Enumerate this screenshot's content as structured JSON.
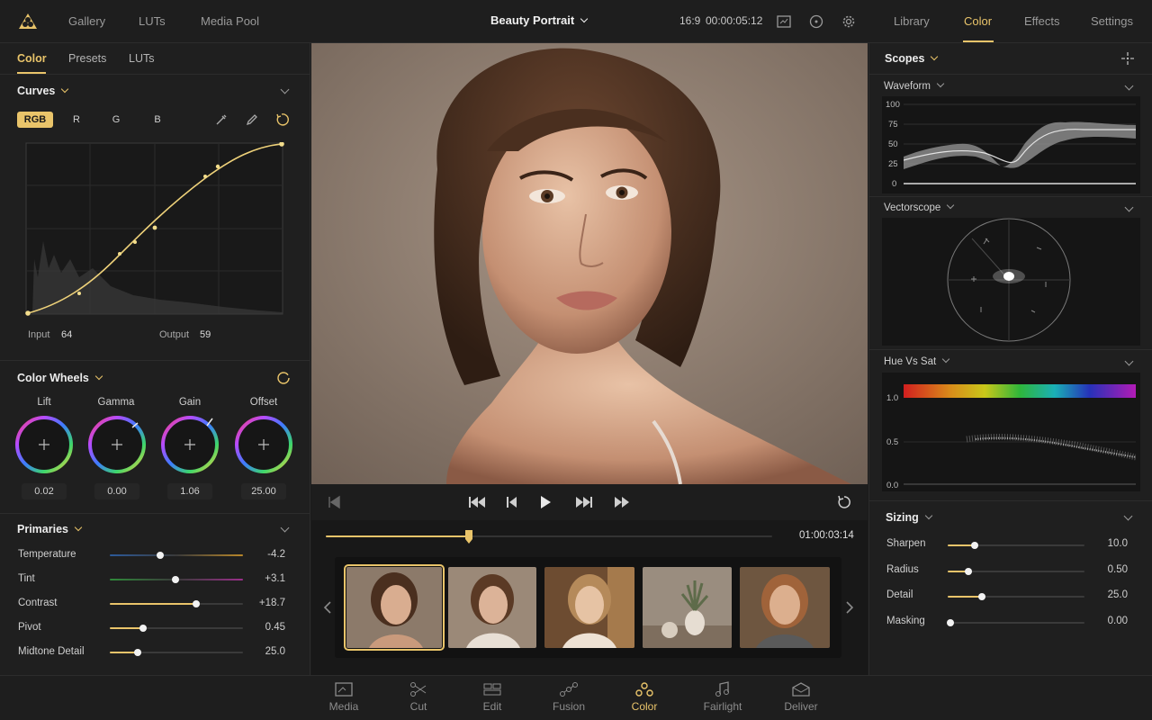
{
  "topbar": {
    "nav_left": [
      "Gallery",
      "LUTs",
      "Media Pool"
    ],
    "project_title": "Beauty Portrait",
    "aspect": "16:9",
    "timecode": "00:00:05:12",
    "nav_right": [
      "Library",
      "Color",
      "Effects",
      "Settings"
    ],
    "active_right": "Color"
  },
  "left_panel": {
    "tabs": [
      "Color",
      "Presets",
      "LUTs"
    ],
    "active_tab": "Color",
    "curves": {
      "title": "Curves",
      "channels": [
        "RGB",
        "R",
        "G",
        "B"
      ],
      "active_channel": "RGB",
      "input_label": "Input",
      "input_value": "64",
      "output_label": "Output",
      "output_value": "59"
    },
    "color_wheels": {
      "title": "Color Wheels",
      "wheels": [
        {
          "label": "Lift",
          "value": "0.02"
        },
        {
          "label": "Gamma",
          "value": "0.00"
        },
        {
          "label": "Gain",
          "value": "1.06"
        },
        {
          "label": "Offset",
          "value": "25.00"
        }
      ]
    },
    "primaries": {
      "title": "Primaries",
      "rows": [
        {
          "label": "Temperature",
          "value": "-4.2",
          "level": 0.38
        },
        {
          "label": "Tint",
          "value": "+3.1",
          "level": 0.49
        },
        {
          "label": "Contrast",
          "value": "+18.7",
          "level": 0.65
        },
        {
          "label": "Pivot",
          "value": "0.45",
          "level": 0.25
        },
        {
          "label": "Midtone Detail",
          "value": "25.0",
          "level": 0.21
        }
      ]
    }
  },
  "viewer": {
    "timecode": "01:00:03:14",
    "scrub_level": 0.32
  },
  "right_panel": {
    "scopes_title": "Scopes",
    "waveform": {
      "title": "Waveform",
      "ticks": [
        "100",
        "75",
        "50",
        "25",
        "0"
      ]
    },
    "vectorscope": {
      "title": "Vectorscope"
    },
    "hue_vs_sat": {
      "title": "Hue Vs Sat",
      "ticks": [
        "1.0",
        "0.5",
        "0.0"
      ]
    },
    "sizing": {
      "title": "Sizing",
      "rows": [
        {
          "label": "Sharpen",
          "value": "10.0",
          "level": 0.2
        },
        {
          "label": "Radius",
          "value": "0.50",
          "level": 0.15
        },
        {
          "label": "Detail",
          "value": "25.0",
          "level": 0.25
        },
        {
          "label": "Masking",
          "value": "0.00",
          "level": 0.02
        }
      ]
    }
  },
  "bottom_nav": {
    "items": [
      "Media",
      "Cut",
      "Edit",
      "Fusion",
      "Color",
      "Fairlight",
      "Deliver"
    ],
    "active": "Color"
  },
  "colors": {
    "accent": "#e9c46a",
    "panel": "#1f1f1f",
    "background": "#1b1b1b"
  }
}
